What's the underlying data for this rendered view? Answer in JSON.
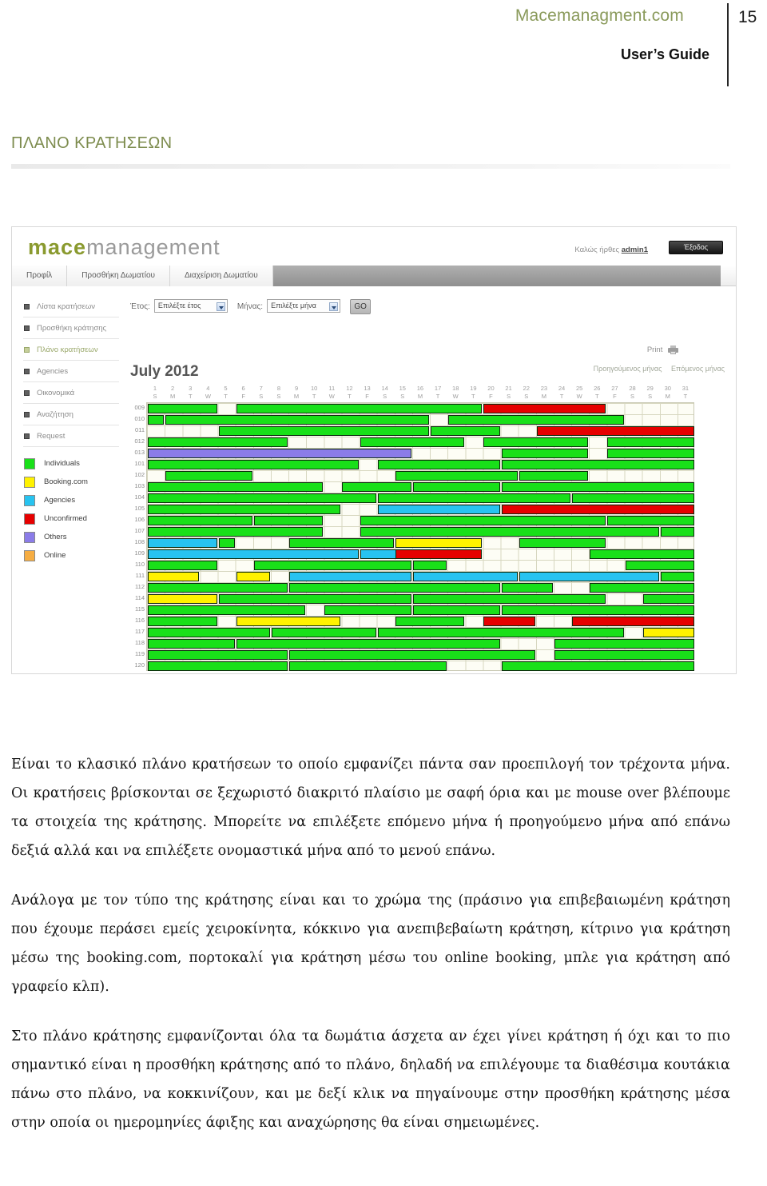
{
  "page_header": {
    "site": "Macemanagment.com",
    "page_number": "15",
    "guide_title": "User’s Guide"
  },
  "section": {
    "title": "ΠΛΑΝΟ ΚΡΑΤΗΣΕΩΝ"
  },
  "app": {
    "logo": {
      "part_a": "mace",
      "part_b": "management"
    },
    "welcome_prefix": "Καλώς ήρθες",
    "username": "admin1",
    "logout_label": "Έξοδος",
    "tabs": [
      {
        "label": "Προφίλ"
      },
      {
        "label": "Προσθήκη Δωματίου"
      },
      {
        "label": "Διαχείριση Δωματίου"
      }
    ],
    "sidebar": {
      "items": [
        {
          "label": "Λίστα κρατήσεων",
          "active": false
        },
        {
          "label": "Προσθήκη κράτησης",
          "active": false
        },
        {
          "label": "Πλάνο κρατήσεων",
          "active": true
        },
        {
          "label": "Agencies",
          "active": false
        },
        {
          "label": "Οικονομικά",
          "active": false
        },
        {
          "label": "Αναζήτηση",
          "active": false
        },
        {
          "label": "Request",
          "active": false
        }
      ],
      "legend": [
        {
          "label": "Individuals",
          "color": "#19e019"
        },
        {
          "label": "Booking.com",
          "color": "#fff200"
        },
        {
          "label": "Agencies",
          "color": "#27c3f0"
        },
        {
          "label": "Unconfirmed",
          "color": "#e60000"
        },
        {
          "label": "Others",
          "color": "#8b7ce8"
        },
        {
          "label": "Online",
          "color": "#f6ad42"
        }
      ]
    },
    "filter": {
      "year_label": "Έτος:",
      "year_value": "Επιλέξτε έτος",
      "month_label": "Μήνας:",
      "month_value": "Επιλέξτε μήνα",
      "go_label": "GO"
    },
    "print_label": "Print",
    "nav": {
      "prev_month": "Προηγούμενος μήνας",
      "next_month": "Επόμενος μήνας"
    },
    "plan": {
      "month_title": "July 2012",
      "day_numbers": [
        "1",
        "2",
        "3",
        "4",
        "5",
        "6",
        "7",
        "8",
        "9",
        "10",
        "11",
        "12",
        "13",
        "14",
        "15",
        "16",
        "17",
        "18",
        "19",
        "20",
        "21",
        "22",
        "23",
        "24",
        "25",
        "26",
        "27",
        "28",
        "29",
        "30",
        "31"
      ],
      "day_letters": [
        "S",
        "M",
        "T",
        "W",
        "T",
        "F",
        "S",
        "S",
        "M",
        "T",
        "W",
        "T",
        "F",
        "S",
        "S",
        "M",
        "T",
        "W",
        "T",
        "F",
        "S",
        "S",
        "M",
        "T",
        "W",
        "T",
        "F",
        "S",
        "S",
        "M",
        "T"
      ],
      "rooms": [
        "009",
        "010",
        "011",
        "012",
        "013",
        "101",
        "102",
        "103",
        "104",
        "105",
        "106",
        "107",
        "108",
        "109",
        "110",
        "111",
        "112",
        "114",
        "115",
        "116",
        "117",
        "118",
        "119",
        "120"
      ],
      "bookings": [
        {
          "room": 0,
          "start": 1,
          "end": 4,
          "type": "green"
        },
        {
          "room": 0,
          "start": 6,
          "end": 19,
          "type": "green"
        },
        {
          "room": 0,
          "start": 20,
          "end": 26,
          "type": "red"
        },
        {
          "room": 1,
          "start": 1,
          "end": 1,
          "type": "green"
        },
        {
          "room": 1,
          "start": 2,
          "end": 16,
          "type": "green"
        },
        {
          "room": 1,
          "start": 18,
          "end": 27,
          "type": "green"
        },
        {
          "room": 2,
          "start": 5,
          "end": 16,
          "type": "green"
        },
        {
          "room": 2,
          "start": 17,
          "end": 20,
          "type": "green"
        },
        {
          "room": 2,
          "start": 23,
          "end": 31,
          "type": "red"
        },
        {
          "room": 3,
          "start": 1,
          "end": 8,
          "type": "green"
        },
        {
          "room": 3,
          "start": 13,
          "end": 18,
          "type": "green"
        },
        {
          "room": 3,
          "start": 20,
          "end": 25,
          "type": "green"
        },
        {
          "room": 3,
          "start": 27,
          "end": 31,
          "type": "green"
        },
        {
          "room": 4,
          "start": 1,
          "end": 15,
          "type": "others"
        },
        {
          "room": 4,
          "start": 21,
          "end": 25,
          "type": "green"
        },
        {
          "room": 4,
          "start": 27,
          "end": 31,
          "type": "green"
        },
        {
          "room": 5,
          "start": 1,
          "end": 12,
          "type": "green"
        },
        {
          "room": 5,
          "start": 14,
          "end": 20,
          "type": "green"
        },
        {
          "room": 5,
          "start": 21,
          "end": 31,
          "type": "green"
        },
        {
          "room": 6,
          "start": 2,
          "end": 6,
          "type": "green"
        },
        {
          "room": 6,
          "start": 15,
          "end": 21,
          "type": "green"
        },
        {
          "room": 6,
          "start": 22,
          "end": 25,
          "type": "green"
        },
        {
          "room": 7,
          "start": 1,
          "end": 10,
          "type": "green"
        },
        {
          "room": 7,
          "start": 12,
          "end": 15,
          "type": "green"
        },
        {
          "room": 7,
          "start": 16,
          "end": 20,
          "type": "green"
        },
        {
          "room": 7,
          "start": 21,
          "end": 31,
          "type": "green"
        },
        {
          "room": 8,
          "start": 1,
          "end": 13,
          "type": "green"
        },
        {
          "room": 8,
          "start": 14,
          "end": 24,
          "type": "green"
        },
        {
          "room": 8,
          "start": 25,
          "end": 31,
          "type": "green"
        },
        {
          "room": 9,
          "start": 1,
          "end": 11,
          "type": "green"
        },
        {
          "room": 9,
          "start": 14,
          "end": 20,
          "type": "agency"
        },
        {
          "room": 9,
          "start": 21,
          "end": 31,
          "type": "red"
        },
        {
          "room": 10,
          "start": 1,
          "end": 6,
          "type": "green"
        },
        {
          "room": 10,
          "start": 7,
          "end": 10,
          "type": "green"
        },
        {
          "room": 10,
          "start": 13,
          "end": 26,
          "type": "green"
        },
        {
          "room": 10,
          "start": 27,
          "end": 31,
          "type": "green"
        },
        {
          "room": 11,
          "start": 1,
          "end": 10,
          "type": "green"
        },
        {
          "room": 11,
          "start": 13,
          "end": 29,
          "type": "green"
        },
        {
          "room": 11,
          "start": 30,
          "end": 31,
          "type": "green"
        },
        {
          "room": 12,
          "start": 1,
          "end": 4,
          "type": "agency"
        },
        {
          "room": 12,
          "start": 5,
          "end": 5,
          "type": "green"
        },
        {
          "room": 12,
          "start": 9,
          "end": 14,
          "type": "green"
        },
        {
          "room": 12,
          "start": 15,
          "end": 19,
          "type": "yellow"
        },
        {
          "room": 12,
          "start": 22,
          "end": 26,
          "type": "green"
        },
        {
          "room": 13,
          "start": 1,
          "end": 12,
          "type": "agency"
        },
        {
          "room": 13,
          "start": 13,
          "end": 15,
          "type": "agency"
        },
        {
          "room": 13,
          "start": 15,
          "end": 19,
          "type": "red"
        },
        {
          "room": 13,
          "start": 26,
          "end": 31,
          "type": "green"
        },
        {
          "room": 14,
          "start": 1,
          "end": 4,
          "type": "green"
        },
        {
          "room": 14,
          "start": 7,
          "end": 15,
          "type": "green"
        },
        {
          "room": 14,
          "start": 16,
          "end": 17,
          "type": "green"
        },
        {
          "room": 14,
          "start": 28,
          "end": 31,
          "type": "green"
        },
        {
          "room": 15,
          "start": 1,
          "end": 3,
          "type": "yellow"
        },
        {
          "room": 15,
          "start": 6,
          "end": 7,
          "type": "yellow"
        },
        {
          "room": 15,
          "start": 9,
          "end": 15,
          "type": "agency"
        },
        {
          "room": 15,
          "start": 16,
          "end": 21,
          "type": "agency"
        },
        {
          "room": 15,
          "start": 22,
          "end": 29,
          "type": "agency"
        },
        {
          "room": 15,
          "start": 30,
          "end": 31,
          "type": "green"
        },
        {
          "room": 16,
          "start": 1,
          "end": 8,
          "type": "green"
        },
        {
          "room": 16,
          "start": 9,
          "end": 20,
          "type": "green"
        },
        {
          "room": 16,
          "start": 21,
          "end": 23,
          "type": "green"
        },
        {
          "room": 16,
          "start": 26,
          "end": 31,
          "type": "green"
        },
        {
          "room": 17,
          "start": 1,
          "end": 4,
          "type": "yellow"
        },
        {
          "room": 17,
          "start": 5,
          "end": 15,
          "type": "green"
        },
        {
          "room": 17,
          "start": 16,
          "end": 26,
          "type": "green"
        },
        {
          "room": 17,
          "start": 29,
          "end": 31,
          "type": "green"
        },
        {
          "room": 18,
          "start": 1,
          "end": 9,
          "type": "green"
        },
        {
          "room": 18,
          "start": 11,
          "end": 15,
          "type": "green"
        },
        {
          "room": 18,
          "start": 16,
          "end": 20,
          "type": "green"
        },
        {
          "room": 18,
          "start": 21,
          "end": 31,
          "type": "green"
        },
        {
          "room": 19,
          "start": 1,
          "end": 4,
          "type": "green"
        },
        {
          "room": 19,
          "start": 6,
          "end": 11,
          "type": "yellow"
        },
        {
          "room": 19,
          "start": 15,
          "end": 18,
          "type": "green"
        },
        {
          "room": 19,
          "start": 20,
          "end": 22,
          "type": "red"
        },
        {
          "room": 19,
          "start": 25,
          "end": 31,
          "type": "red"
        },
        {
          "room": 20,
          "start": 1,
          "end": 7,
          "type": "green"
        },
        {
          "room": 20,
          "start": 8,
          "end": 13,
          "type": "green"
        },
        {
          "room": 20,
          "start": 14,
          "end": 27,
          "type": "green"
        },
        {
          "room": 20,
          "start": 29,
          "end": 31,
          "type": "yellow"
        },
        {
          "room": 21,
          "start": 1,
          "end": 5,
          "type": "green"
        },
        {
          "room": 21,
          "start": 6,
          "end": 20,
          "type": "green"
        },
        {
          "room": 21,
          "start": 24,
          "end": 31,
          "type": "green"
        },
        {
          "room": 22,
          "start": 1,
          "end": 8,
          "type": "green"
        },
        {
          "room": 22,
          "start": 9,
          "end": 22,
          "type": "green"
        },
        {
          "room": 22,
          "start": 24,
          "end": 31,
          "type": "green"
        },
        {
          "room": 23,
          "start": 1,
          "end": 8,
          "type": "green"
        },
        {
          "room": 23,
          "start": 9,
          "end": 17,
          "type": "green"
        },
        {
          "room": 23,
          "start": 21,
          "end": 31,
          "type": "green"
        }
      ],
      "type_colors": {
        "green": "#19e019",
        "yellow": "#fff200",
        "agency": "#27c3f0",
        "red": "#e60000",
        "others": "#8b7ce8",
        "online": "#f6ad42"
      }
    }
  },
  "body_text": {
    "paragraphs": [
      "Είναι το κλασικό πλάνο κρατήσεων το οποίο εμφανίζει πάντα σαν προεπιλογή τον τρέχοντα μήνα. Οι κρατήσεις βρίσκονται σε ξεχωριστό διακριτό πλαίσιο με σαφή όρια και με mouse over βλέπουμε τα στοιχεία της κράτησης. Μπορείτε να επιλέξετε επόμενο μήνα ή προηγούμενο μήνα από επάνω δεξιά αλλά και να επιλέξετε ονομαστικά μήνα από το μενού επάνω.",
      "Ανάλογα με τον τύπο της κράτησης είναι και το χρώμα της (πράσινο για επιβεβαιωμένη κράτηση που έχουμε περάσει εμείς χειροκίνητα, κόκκινο για ανεπιβεβαίωτη κράτηση, κίτρινο για κράτηση μέσω της booking.com, πορτοκαλί για κράτηση μέσω του online booking, μπλε για κράτηση από γραφείο κλπ).",
      "Στο πλάνο κράτησης  εμφανίζονται όλα τα δωμάτια άσχετα αν έχει γίνει κράτηση ή όχι και το πιο σημαντικό είναι η προσθήκη κράτησης από το πλάνο, δηλαδή  να επιλέγουμε  τα διαθέσιμα κουτάκια πάνω στο πλάνο, να κοκκινίζουν, και με δεξί κλικ να πηγαίνουμε  στην προσθήκη κράτησης μέσα στην οποία οι ημερομηνίες άφιξης και αναχώρησης θα είναι σημειωμένες."
    ]
  }
}
